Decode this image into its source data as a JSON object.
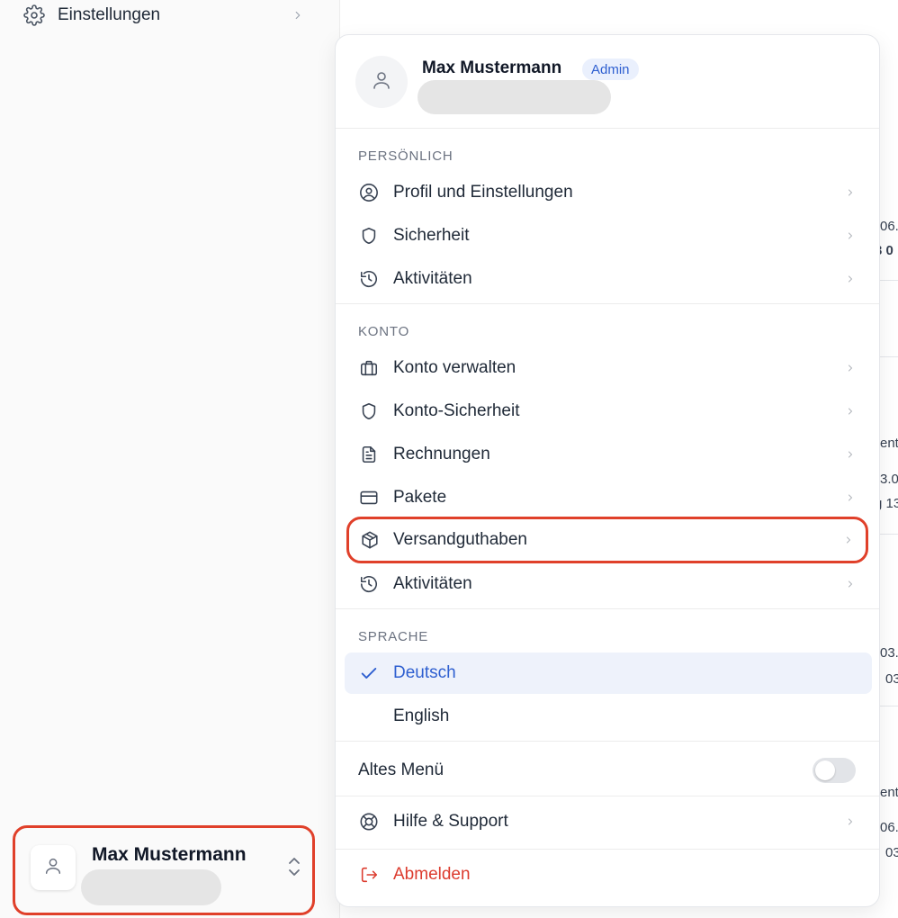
{
  "sidebar": {
    "settings_label": "Einstellungen",
    "user": {
      "name": "Max Mustermann"
    }
  },
  "background_fragments": [
    "06.",
    "3 0",
    "ent",
    "3.0",
    "g 13",
    "03.",
    "03",
    "ent",
    "06.",
    "03"
  ],
  "menu": {
    "user": {
      "name": "Max Mustermann",
      "badge": "Admin"
    },
    "sections": {
      "personal": {
        "label": "PERSÖNLICH",
        "items": [
          {
            "label": "Profil und Einstellungen",
            "icon": "user-circle-icon"
          },
          {
            "label": "Sicherheit",
            "icon": "shield-icon"
          },
          {
            "label": "Aktivitäten",
            "icon": "history-icon"
          }
        ]
      },
      "account": {
        "label": "KONTO",
        "items": [
          {
            "label": "Konto verwalten",
            "icon": "briefcase-icon"
          },
          {
            "label": "Konto-Sicherheit",
            "icon": "shield-icon"
          },
          {
            "label": "Rechnungen",
            "icon": "document-icon"
          },
          {
            "label": "Pakete",
            "icon": "credit-card-icon"
          },
          {
            "label": "Versandguthaben",
            "icon": "package-icon"
          },
          {
            "label": "Aktivitäten",
            "icon": "history-icon"
          }
        ]
      },
      "language": {
        "label": "SPRACHE",
        "items": [
          {
            "label": "Deutsch",
            "selected": true
          },
          {
            "label": "English",
            "selected": false
          }
        ]
      }
    },
    "old_menu": {
      "label": "Altes Menü",
      "enabled": false
    },
    "help_label": "Hilfe & Support",
    "logout_label": "Abmelden"
  },
  "colors": {
    "accent": "#2e5fd0",
    "highlight_border": "#e0402a",
    "logout": "#dc3b2e"
  }
}
